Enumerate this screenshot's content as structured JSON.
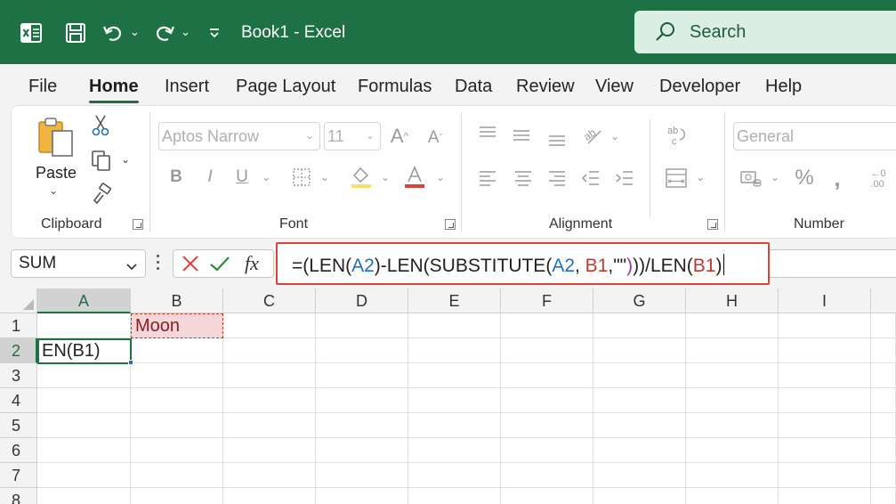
{
  "titlebar": {
    "doc_title": "Book1  -  Excel",
    "search_placeholder": "Search",
    "colors": {
      "bar": "#1e7145",
      "search_bg": "#dbeee3"
    }
  },
  "menu": {
    "tabs": [
      "File",
      "Home",
      "Insert",
      "Page Layout",
      "Formulas",
      "Data",
      "Review",
      "View",
      "Developer",
      "Help"
    ],
    "active": "Home"
  },
  "ribbon": {
    "clipboard": {
      "paste_label": "Paste",
      "group_label": "Clipboard"
    },
    "font": {
      "font_name": "Aptos Narrow",
      "font_size": "11",
      "group_label": "Font"
    },
    "alignment": {
      "group_label": "Alignment"
    },
    "number": {
      "format": "General",
      "group_label": "Number"
    }
  },
  "formula_bar": {
    "name_box": "SUM",
    "fx_label": "fx",
    "formula_parts": [
      "=(LEN(",
      "A2",
      ")-LEN(",
      "SUBSTITUTE(",
      "A2",
      ", ",
      "B1",
      ",",
      "\"\"",
      ")",
      "))/LEN(",
      "B1",
      ")"
    ]
  },
  "grid": {
    "columns": [
      "A",
      "B",
      "C",
      "D",
      "E",
      "F",
      "G",
      "H",
      "I"
    ],
    "rows": [
      "1",
      "2",
      "3",
      "4",
      "5",
      "6",
      "7",
      "8"
    ],
    "cells": {
      "B1": "Moon",
      "A2": "EN(B1)"
    },
    "selected_column": "A",
    "selected_row": "2"
  }
}
